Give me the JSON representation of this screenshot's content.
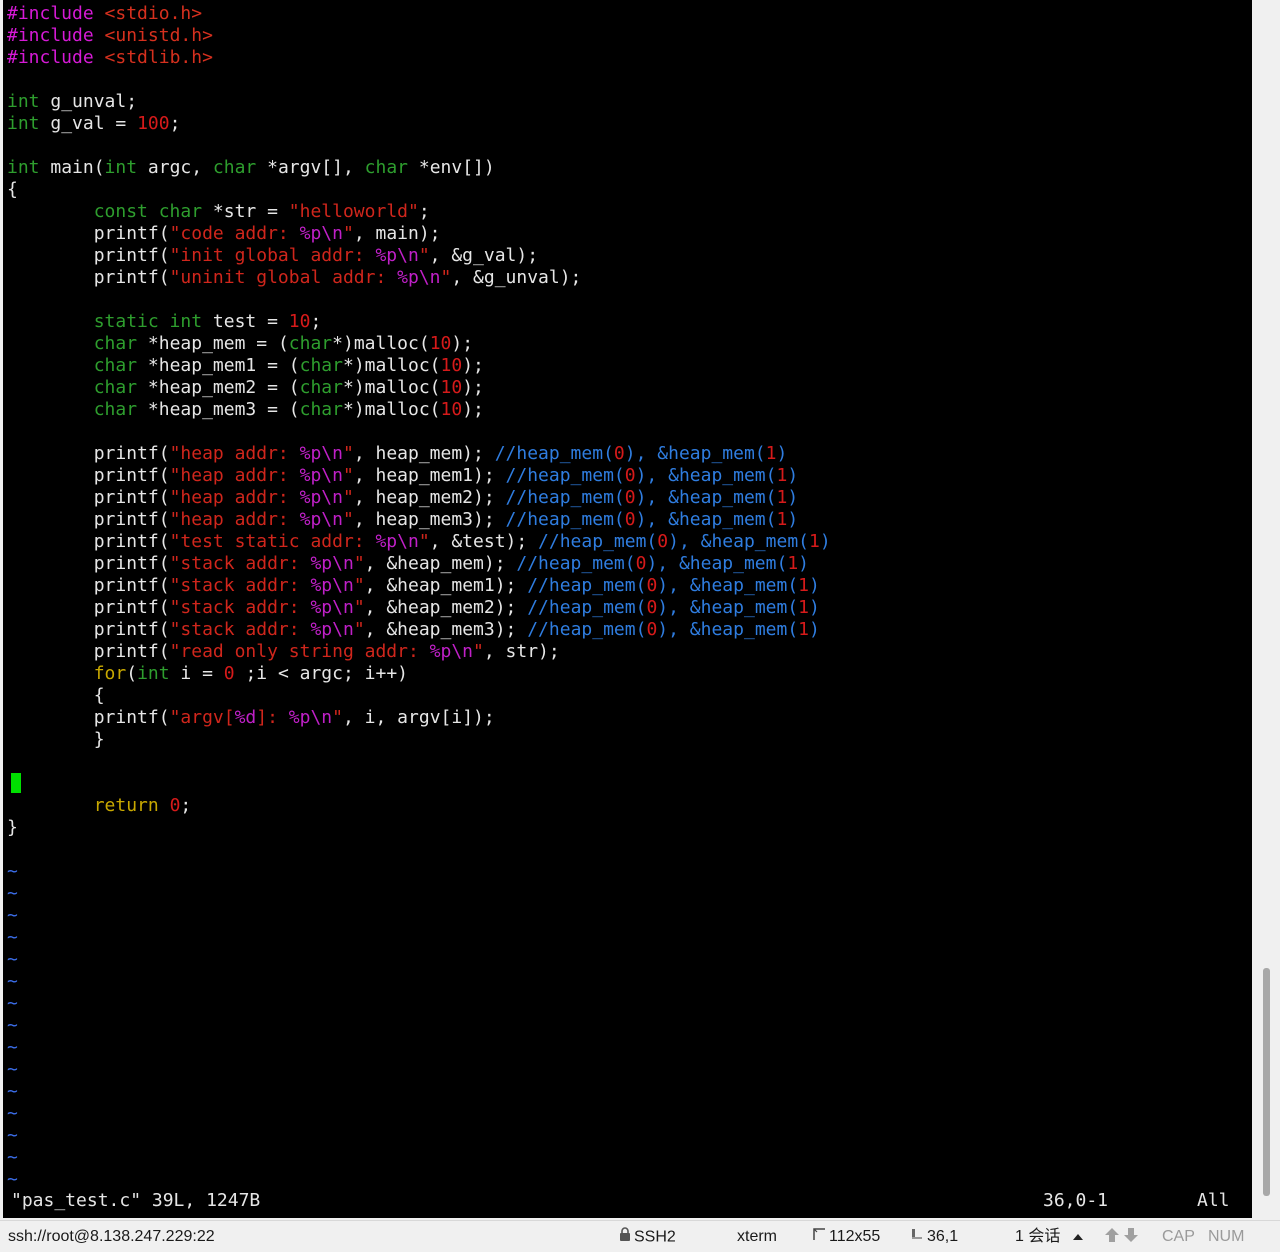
{
  "editor": {
    "code_lines": [
      [
        [
          "k-pre",
          "#include "
        ],
        [
          "k-inc",
          "<stdio.h>"
        ]
      ],
      [
        [
          "k-pre",
          "#include "
        ],
        [
          "k-inc",
          "<unistd.h>"
        ]
      ],
      [
        [
          "k-pre",
          "#include "
        ],
        [
          "k-inc",
          "<stdlib.h>"
        ]
      ],
      [],
      [
        [
          "k-type",
          "int"
        ],
        [
          "k-plain",
          " g_unval;"
        ]
      ],
      [
        [
          "k-type",
          "int"
        ],
        [
          "k-plain",
          " g_val = "
        ],
        [
          "k-num",
          "100"
        ],
        [
          "k-plain",
          ";"
        ]
      ],
      [],
      [
        [
          "k-type",
          "int"
        ],
        [
          "k-plain",
          " main("
        ],
        [
          "k-type",
          "int"
        ],
        [
          "k-plain",
          " argc, "
        ],
        [
          "k-type",
          "char"
        ],
        [
          "k-plain",
          " *argv[], "
        ],
        [
          "k-type",
          "char"
        ],
        [
          "k-plain",
          " *env[])"
        ]
      ],
      [
        [
          "k-plain",
          "{"
        ]
      ],
      [
        [
          "k-plain",
          "        "
        ],
        [
          "k-type",
          "const char"
        ],
        [
          "k-plain",
          " *str = "
        ],
        [
          "k-str",
          "\"helloworld\""
        ],
        [
          "k-plain",
          ";"
        ]
      ],
      [
        [
          "k-plain",
          "        printf("
        ],
        [
          "k-str",
          "\"code addr: "
        ],
        [
          "k-fmt",
          "%p\\n"
        ],
        [
          "k-str",
          "\""
        ],
        [
          "k-plain",
          ", main);"
        ]
      ],
      [
        [
          "k-plain",
          "        printf("
        ],
        [
          "k-str",
          "\"init global addr: "
        ],
        [
          "k-fmt",
          "%p\\n"
        ],
        [
          "k-str",
          "\""
        ],
        [
          "k-plain",
          ", &g_val);"
        ]
      ],
      [
        [
          "k-plain",
          "        printf("
        ],
        [
          "k-str",
          "\"uninit global addr: "
        ],
        [
          "k-fmt",
          "%p\\n"
        ],
        [
          "k-str",
          "\""
        ],
        [
          "k-plain",
          ", &g_unval);"
        ]
      ],
      [],
      [
        [
          "k-plain",
          "        "
        ],
        [
          "k-type",
          "static int"
        ],
        [
          "k-plain",
          " test = "
        ],
        [
          "k-num",
          "10"
        ],
        [
          "k-plain",
          ";"
        ]
      ],
      [
        [
          "k-plain",
          "        "
        ],
        [
          "k-type",
          "char"
        ],
        [
          "k-plain",
          " *heap_mem = ("
        ],
        [
          "k-type",
          "char"
        ],
        [
          "k-plain",
          "*)malloc("
        ],
        [
          "k-num",
          "10"
        ],
        [
          "k-plain",
          ");"
        ]
      ],
      [
        [
          "k-plain",
          "        "
        ],
        [
          "k-type",
          "char"
        ],
        [
          "k-plain",
          " *heap_mem1 = ("
        ],
        [
          "k-type",
          "char"
        ],
        [
          "k-plain",
          "*)malloc("
        ],
        [
          "k-num",
          "10"
        ],
        [
          "k-plain",
          ");"
        ]
      ],
      [
        [
          "k-plain",
          "        "
        ],
        [
          "k-type",
          "char"
        ],
        [
          "k-plain",
          " *heap_mem2 = ("
        ],
        [
          "k-type",
          "char"
        ],
        [
          "k-plain",
          "*)malloc("
        ],
        [
          "k-num",
          "10"
        ],
        [
          "k-plain",
          ");"
        ]
      ],
      [
        [
          "k-plain",
          "        "
        ],
        [
          "k-type",
          "char"
        ],
        [
          "k-plain",
          " *heap_mem3 = ("
        ],
        [
          "k-type",
          "char"
        ],
        [
          "k-plain",
          "*)malloc("
        ],
        [
          "k-num",
          "10"
        ],
        [
          "k-plain",
          ");"
        ]
      ],
      [],
      [
        [
          "k-plain",
          "        printf("
        ],
        [
          "k-str",
          "\"heap addr: "
        ],
        [
          "k-fmt",
          "%p\\n"
        ],
        [
          "k-str",
          "\""
        ],
        [
          "k-plain",
          ", heap_mem); "
        ],
        [
          "k-cmt",
          "//heap_mem("
        ],
        [
          "k-cnum",
          "0"
        ],
        [
          "k-cmt",
          "), &heap_mem("
        ],
        [
          "k-cnum",
          "1"
        ],
        [
          "k-cmt",
          ")"
        ]
      ],
      [
        [
          "k-plain",
          "        printf("
        ],
        [
          "k-str",
          "\"heap addr: "
        ],
        [
          "k-fmt",
          "%p\\n"
        ],
        [
          "k-str",
          "\""
        ],
        [
          "k-plain",
          ", heap_mem1); "
        ],
        [
          "k-cmt",
          "//heap_mem("
        ],
        [
          "k-cnum",
          "0"
        ],
        [
          "k-cmt",
          "), &heap_mem("
        ],
        [
          "k-cnum",
          "1"
        ],
        [
          "k-cmt",
          ")"
        ]
      ],
      [
        [
          "k-plain",
          "        printf("
        ],
        [
          "k-str",
          "\"heap addr: "
        ],
        [
          "k-fmt",
          "%p\\n"
        ],
        [
          "k-str",
          "\""
        ],
        [
          "k-plain",
          ", heap_mem2); "
        ],
        [
          "k-cmt",
          "//heap_mem("
        ],
        [
          "k-cnum",
          "0"
        ],
        [
          "k-cmt",
          "), &heap_mem("
        ],
        [
          "k-cnum",
          "1"
        ],
        [
          "k-cmt",
          ")"
        ]
      ],
      [
        [
          "k-plain",
          "        printf("
        ],
        [
          "k-str",
          "\"heap addr: "
        ],
        [
          "k-fmt",
          "%p\\n"
        ],
        [
          "k-str",
          "\""
        ],
        [
          "k-plain",
          ", heap_mem3); "
        ],
        [
          "k-cmt",
          "//heap_mem("
        ],
        [
          "k-cnum",
          "0"
        ],
        [
          "k-cmt",
          "), &heap_mem("
        ],
        [
          "k-cnum",
          "1"
        ],
        [
          "k-cmt",
          ")"
        ]
      ],
      [
        [
          "k-plain",
          "        printf("
        ],
        [
          "k-str",
          "\"test static addr: "
        ],
        [
          "k-fmt",
          "%p\\n"
        ],
        [
          "k-str",
          "\""
        ],
        [
          "k-plain",
          ", &test); "
        ],
        [
          "k-cmt",
          "//heap_mem("
        ],
        [
          "k-cnum",
          "0"
        ],
        [
          "k-cmt",
          "), &heap_mem("
        ],
        [
          "k-cnum",
          "1"
        ],
        [
          "k-cmt",
          ")"
        ]
      ],
      [
        [
          "k-plain",
          "        printf("
        ],
        [
          "k-str",
          "\"stack addr: "
        ],
        [
          "k-fmt",
          "%p\\n"
        ],
        [
          "k-str",
          "\""
        ],
        [
          "k-plain",
          ", &heap_mem); "
        ],
        [
          "k-cmt",
          "//heap_mem("
        ],
        [
          "k-cnum",
          "0"
        ],
        [
          "k-cmt",
          "), &heap_mem("
        ],
        [
          "k-cnum",
          "1"
        ],
        [
          "k-cmt",
          ")"
        ]
      ],
      [
        [
          "k-plain",
          "        printf("
        ],
        [
          "k-str",
          "\"stack addr: "
        ],
        [
          "k-fmt",
          "%p\\n"
        ],
        [
          "k-str",
          "\""
        ],
        [
          "k-plain",
          ", &heap_mem1); "
        ],
        [
          "k-cmt",
          "//heap_mem("
        ],
        [
          "k-cnum",
          "0"
        ],
        [
          "k-cmt",
          "), &heap_mem("
        ],
        [
          "k-cnum",
          "1"
        ],
        [
          "k-cmt",
          ")"
        ]
      ],
      [
        [
          "k-plain",
          "        printf("
        ],
        [
          "k-str",
          "\"stack addr: "
        ],
        [
          "k-fmt",
          "%p\\n"
        ],
        [
          "k-str",
          "\""
        ],
        [
          "k-plain",
          ", &heap_mem2); "
        ],
        [
          "k-cmt",
          "//heap_mem("
        ],
        [
          "k-cnum",
          "0"
        ],
        [
          "k-cmt",
          "), &heap_mem("
        ],
        [
          "k-cnum",
          "1"
        ],
        [
          "k-cmt",
          ")"
        ]
      ],
      [
        [
          "k-plain",
          "        printf("
        ],
        [
          "k-str",
          "\"stack addr: "
        ],
        [
          "k-fmt",
          "%p\\n"
        ],
        [
          "k-str",
          "\""
        ],
        [
          "k-plain",
          ", &heap_mem3); "
        ],
        [
          "k-cmt",
          "//heap_mem("
        ],
        [
          "k-cnum",
          "0"
        ],
        [
          "k-cmt",
          "), &heap_mem("
        ],
        [
          "k-cnum",
          "1"
        ],
        [
          "k-cmt",
          ")"
        ]
      ],
      [
        [
          "k-plain",
          "        printf("
        ],
        [
          "k-str",
          "\"read only string addr: "
        ],
        [
          "k-fmt",
          "%p\\n"
        ],
        [
          "k-str",
          "\""
        ],
        [
          "k-plain",
          ", str);"
        ]
      ],
      [
        [
          "k-plain",
          "        "
        ],
        [
          "k-kw",
          "for"
        ],
        [
          "k-plain",
          "("
        ],
        [
          "k-type",
          "int"
        ],
        [
          "k-plain",
          " i = "
        ],
        [
          "k-num",
          "0"
        ],
        [
          "k-plain",
          " ;i < argc; i++)"
        ]
      ],
      [
        [
          "k-plain",
          "        {"
        ]
      ],
      [
        [
          "k-plain",
          "        printf("
        ],
        [
          "k-str",
          "\"argv["
        ],
        [
          "k-fmt",
          "%d"
        ],
        [
          "k-str",
          "]: "
        ],
        [
          "k-fmt",
          "%p\\n"
        ],
        [
          "k-str",
          "\""
        ],
        [
          "k-plain",
          ", i, argv[i]);"
        ]
      ],
      [
        [
          "k-plain",
          "        }"
        ]
      ],
      [],
      [],
      [
        [
          "k-plain",
          "        "
        ],
        [
          "k-kw",
          "return"
        ],
        [
          "k-plain",
          " "
        ],
        [
          "k-num",
          "0"
        ],
        [
          "k-plain",
          ";"
        ]
      ],
      [
        [
          "k-plain",
          "}"
        ]
      ],
      []
    ],
    "tilde_count": 15,
    "tilde_char": "~",
    "status_file": "\"pas_test.c\" 39L, 1247B",
    "status_position": "36,0-1",
    "status_scroll": "All"
  },
  "statusbar": {
    "connection": "ssh://root@8.138.247.229:22",
    "protocol": "SSH2",
    "terminal_type": "xterm",
    "dimensions": "112x55",
    "cursor_pos": "36,1",
    "sessions": "1 会话",
    "cap": "CAP",
    "num": "NUM"
  },
  "colors": {
    "background": "#000000",
    "cursor": "#00e000",
    "preprocessor": "#d61ad6",
    "type": "#2e9e2e",
    "string": "#d0261c",
    "comment": "#2f7de0",
    "keyword": "#c8a800"
  }
}
